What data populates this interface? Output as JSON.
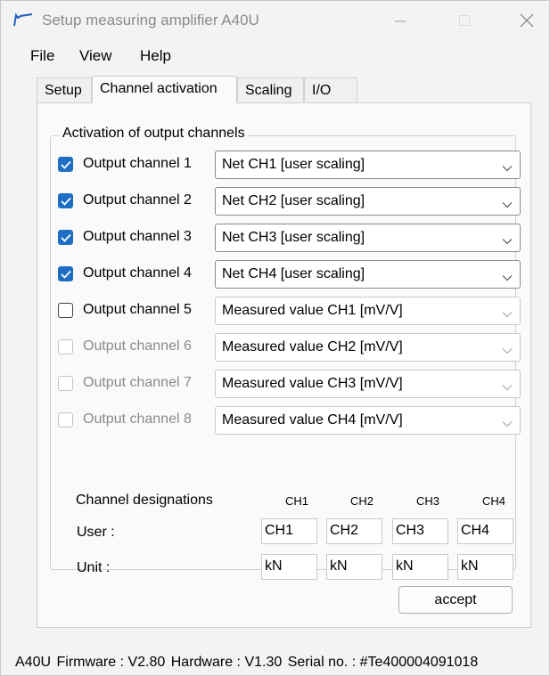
{
  "window": {
    "title": "Setup measuring amplifier A40U"
  },
  "menu": [
    "File",
    "View",
    "Help"
  ],
  "tabs": [
    "Setup",
    "Channel activation",
    "Scaling",
    "I/O"
  ],
  "active_tab": "Channel activation",
  "group_title": "Activation of output channels",
  "channels": [
    {
      "label": "Output channel 1",
      "checked": true,
      "enabled": true,
      "source": "Net CH1 [user scaling]"
    },
    {
      "label": "Output channel 2",
      "checked": true,
      "enabled": true,
      "source": "Net CH2 [user scaling]"
    },
    {
      "label": "Output channel 3",
      "checked": true,
      "enabled": true,
      "source": "Net CH3 [user scaling]"
    },
    {
      "label": "Output channel 4",
      "checked": true,
      "enabled": true,
      "source": "Net CH4 [user scaling]"
    },
    {
      "label": "Output channel 5",
      "checked": false,
      "enabled": true,
      "source": "Measured value CH1 [mV/V]"
    },
    {
      "label": "Output channel 6",
      "checked": false,
      "enabled": false,
      "source": "Measured value CH2 [mV/V]"
    },
    {
      "label": "Output channel 7",
      "checked": false,
      "enabled": false,
      "source": "Measured value CH3 [mV/V]"
    },
    {
      "label": "Output channel 8",
      "checked": false,
      "enabled": false,
      "source": "Measured value CH4 [mV/V]"
    }
  ],
  "designations": {
    "title": "Channel designations",
    "columns": [
      "CH1",
      "CH2",
      "CH3",
      "CH4"
    ],
    "user_label": "User :",
    "user_values": [
      "CH1",
      "CH2",
      "CH3",
      "CH4"
    ],
    "unit_label": "Unit :",
    "unit_values": [
      "kN",
      "kN",
      "kN",
      "kN"
    ]
  },
  "accept_label": "accept",
  "status": {
    "device": "A40U",
    "firmware": "Firmware : V2.80",
    "hardware": "Hardware : V1.30",
    "serial": "Serial no. : #Te400004091018"
  },
  "colors": {
    "checkbox_accent": "#1e6fc4"
  },
  "icons": {
    "app": "signal-curve-icon",
    "dropdown": "chevron-down-icon"
  }
}
